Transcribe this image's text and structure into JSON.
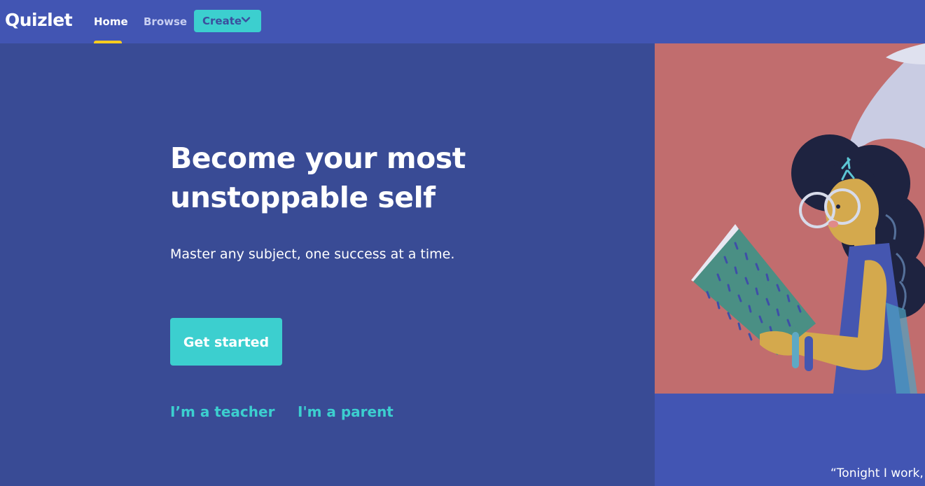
{
  "header": {
    "logo": "Quizlet",
    "nav": {
      "home": "Home",
      "browse": "Browse"
    },
    "create_label": "Create"
  },
  "hero": {
    "title_line1": "Become your most",
    "title_line2": "unstoppable self",
    "subtitle": "Master any subject, one success at a time.",
    "cta_label": "Get started",
    "teacher_link": "I’m a teacher",
    "parent_link": "I'm a parent"
  },
  "testimonial": {
    "quote": "“Tonight I work, s"
  },
  "colors": {
    "header_bg": "#4255b3",
    "hero_bg": "#394b95",
    "accent_teal": "#3ccfcf",
    "active_indicator": "#ffcd1f",
    "illustration_bg": "#c16d6e"
  },
  "icons": {
    "create_dropdown": "chevron-down-icon"
  }
}
